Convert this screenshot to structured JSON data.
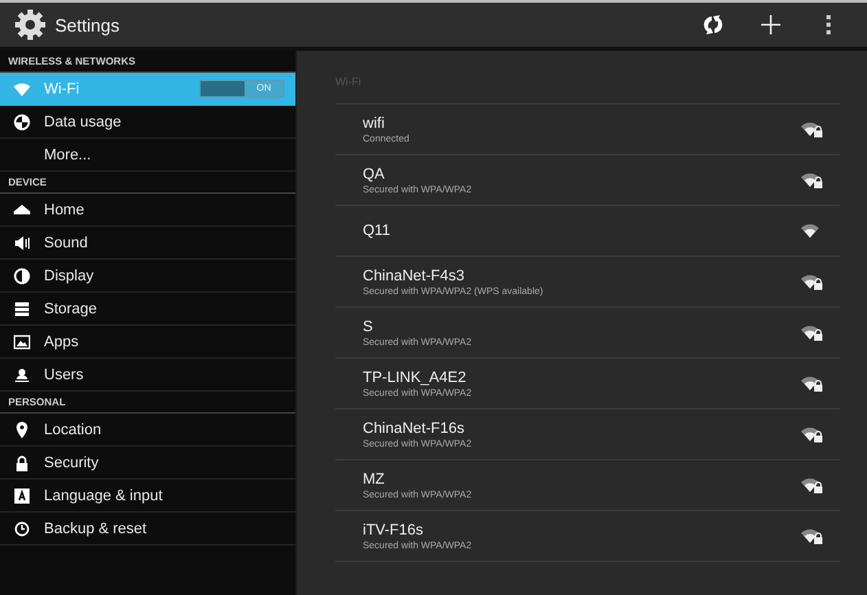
{
  "action_bar": {
    "title": "Settings"
  },
  "sidebar": {
    "sections": [
      {
        "header": "WIRELESS & NETWORKS",
        "items": [
          {
            "label": "Wi-Fi",
            "selected": true,
            "toggle": {
              "label": "ON",
              "on": true
            }
          },
          {
            "label": "Data usage",
            "selected": false
          },
          {
            "label": "More...",
            "selected": false
          }
        ]
      },
      {
        "header": "DEVICE",
        "items": [
          {
            "label": "Home",
            "selected": false
          },
          {
            "label": "Sound",
            "selected": false
          },
          {
            "label": "Display",
            "selected": false
          },
          {
            "label": "Storage",
            "selected": false
          },
          {
            "label": "Apps",
            "selected": false
          },
          {
            "label": "Users",
            "selected": false
          }
        ]
      },
      {
        "header": "PERSONAL",
        "items": [
          {
            "label": "Location",
            "selected": false
          },
          {
            "label": "Security",
            "selected": false
          },
          {
            "label": "Language & input",
            "selected": false
          },
          {
            "label": "Backup & reset",
            "selected": false
          }
        ]
      }
    ]
  },
  "wifi_panel": {
    "header": "Wi-Fi",
    "networks": [
      {
        "name": "wifi",
        "status": "Connected",
        "secured": true
      },
      {
        "name": "QA",
        "status": "Secured with WPA/WPA2",
        "secured": true
      },
      {
        "name": "Q11",
        "secured": false
      },
      {
        "name": "ChinaNet-F4s3",
        "status": "Secured with WPA/WPA2 (WPS available)",
        "secured": true
      },
      {
        "name": "S",
        "status": "Secured with WPA/WPA2",
        "secured": true
      },
      {
        "name": "TP-LINK_A4E2",
        "status": "Secured with WPA/WPA2",
        "secured": true
      },
      {
        "name": "ChinaNet-F16s",
        "status": "Secured with WPA/WPA2",
        "secured": true
      },
      {
        "name": "MZ",
        "status": "Secured with WPA/WPA2",
        "secured": true
      },
      {
        "name": "iTV-F16s",
        "status": "Secured with WPA/WPA2",
        "secured": true
      }
    ]
  }
}
